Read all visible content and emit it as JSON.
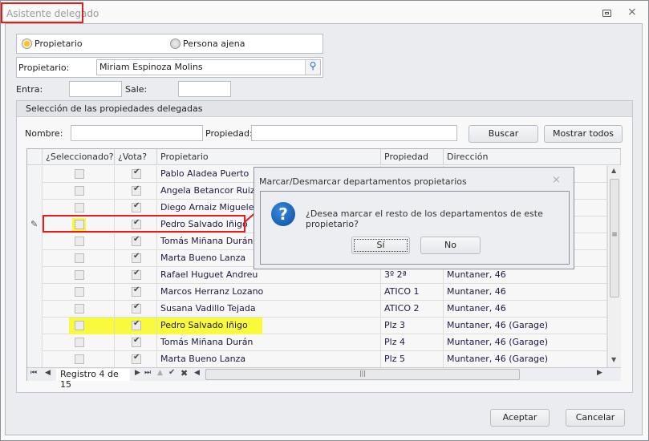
{
  "window": {
    "title": "Asistente delegado",
    "restore_icon": "restore-icon",
    "close_icon": "close-icon"
  },
  "mode": {
    "option1": "Propietario",
    "option2": "Persona ajena",
    "selected": "Propietario"
  },
  "owner": {
    "label": "Propietario:",
    "value": "Miriam Espinoza Molins"
  },
  "dates": {
    "entra_label": "Entra:",
    "sale_label": "Sale:",
    "entra_value": "",
    "sale_value": ""
  },
  "group": {
    "title": "Selección de las propiedades delegadas",
    "nombre_label": "Nombre:",
    "propiedad_label": "Propiedad:",
    "buscar": "Buscar",
    "mostrar_todos": "Mostrar todos"
  },
  "grid": {
    "columns": [
      "¿Seleccionado?",
      "¿Vota?",
      "Propietario",
      "Propiedad",
      "Dirección"
    ],
    "rows": [
      {
        "sel": false,
        "vota": true,
        "owner": "Pablo Aladea Puerto",
        "prop": "",
        "dir": ""
      },
      {
        "sel": false,
        "vota": true,
        "owner": "Angela Betancor Ruiz",
        "prop": "",
        "dir": ""
      },
      {
        "sel": false,
        "vota": true,
        "owner": "Diego Arnaiz Miguelez",
        "prop": "",
        "dir": ""
      },
      {
        "sel": false,
        "vota": true,
        "owner": "Pedro Salvado Iñigo",
        "prop": "",
        "dir": ""
      },
      {
        "sel": false,
        "vota": true,
        "owner": "Tomás Miñana Durán",
        "prop": "",
        "dir": ""
      },
      {
        "sel": false,
        "vota": true,
        "owner": "Marta Bueno Lanza",
        "prop": "",
        "dir": ""
      },
      {
        "sel": false,
        "vota": true,
        "owner": "Rafael Huguet Andreu",
        "prop": "3º 2ª",
        "dir": "Muntaner, 46"
      },
      {
        "sel": false,
        "vota": true,
        "owner": "Marcos Herranz Lozano",
        "prop": "ATICO 1",
        "dir": "Muntaner, 46"
      },
      {
        "sel": false,
        "vota": true,
        "owner": "Susana Vadillo Tejada",
        "prop": "ATICO 2",
        "dir": "Muntaner, 46"
      },
      {
        "sel": false,
        "vota": true,
        "owner": "Pedro Salvado Iñigo",
        "prop": "Plz 3",
        "dir": "Muntaner, 46 (Garage)"
      },
      {
        "sel": false,
        "vota": true,
        "owner": "Tomás Miñana Durán",
        "prop": "Plz 4",
        "dir": "Muntaner, 46 (Garage)"
      },
      {
        "sel": false,
        "vota": true,
        "owner": "Marta Bueno Lanza",
        "prop": "Plz 5",
        "dir": "Muntaner, 46 (Garage)"
      }
    ],
    "record_text": "Registro 4 de 15"
  },
  "dialog": {
    "title": "Marcar/Desmarcar departamentos propietarios",
    "message": "¿Desea marcar el resto de los departamentos de este propietario?",
    "yes": "Sí",
    "no": "No"
  },
  "footer": {
    "accept": "Aceptar",
    "cancel": "Cancelar"
  },
  "colors": {
    "highlight": "#fafa3c",
    "annotation": "#e41c1c",
    "accent": "#f7c21b"
  }
}
